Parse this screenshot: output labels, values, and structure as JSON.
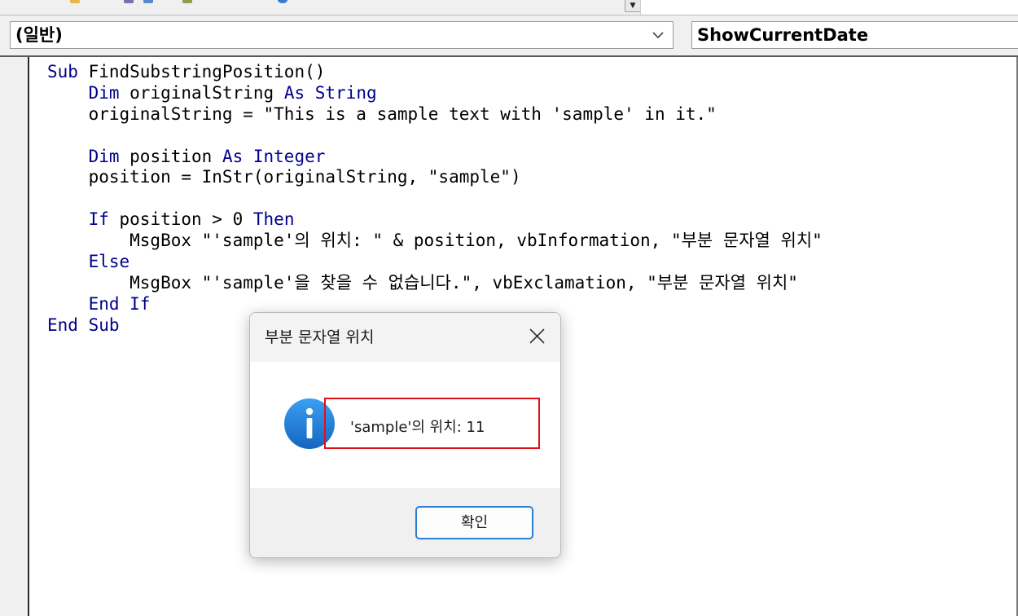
{
  "object_combo": {
    "value": "(일반)"
  },
  "procedure_combo": {
    "value": "ShowCurrentDate"
  },
  "code_lines": [
    [
      {
        "t": "Sub ",
        "k": 1
      },
      {
        "t": "FindSubstringPosition()"
      }
    ],
    [
      {
        "t": "    "
      },
      {
        "t": "Dim ",
        "k": 1
      },
      {
        "t": "originalString "
      },
      {
        "t": "As String",
        "k": 1
      }
    ],
    [
      {
        "t": "    originalString = \"This is a sample text with 'sample' in it.\""
      }
    ],
    [],
    [
      {
        "t": "    "
      },
      {
        "t": "Dim ",
        "k": 1
      },
      {
        "t": "position "
      },
      {
        "t": "As Integer",
        "k": 1
      }
    ],
    [
      {
        "t": "    position = InStr(originalString, \"sample\")"
      }
    ],
    [],
    [
      {
        "t": "    "
      },
      {
        "t": "If ",
        "k": 1
      },
      {
        "t": "position > 0 "
      },
      {
        "t": "Then",
        "k": 1
      }
    ],
    [
      {
        "t": "        MsgBox \"'sample'의 위치: \" & position, vbInformation, \"부분 문자열 위치\""
      }
    ],
    [
      {
        "t": "    "
      },
      {
        "t": "Else",
        "k": 1
      }
    ],
    [
      {
        "t": "        MsgBox \"'sample'을 찾을 수 없습니다.\", vbExclamation, \"부분 문자열 위치\""
      }
    ],
    [
      {
        "t": "    "
      },
      {
        "t": "End If",
        "k": 1
      }
    ],
    [
      {
        "t": "End Sub",
        "k": 1
      }
    ]
  ],
  "dialog": {
    "title": "부분 문자열 위치",
    "message": "'sample'의 위치: 11",
    "ok_label": "확인",
    "icon": "info-icon",
    "close_icon": "close-icon"
  },
  "colors": {
    "keyword": "#00008b",
    "highlight_border": "#e0101a",
    "ok_border": "#2d7dd2",
    "info_icon": "#1e88e5"
  }
}
